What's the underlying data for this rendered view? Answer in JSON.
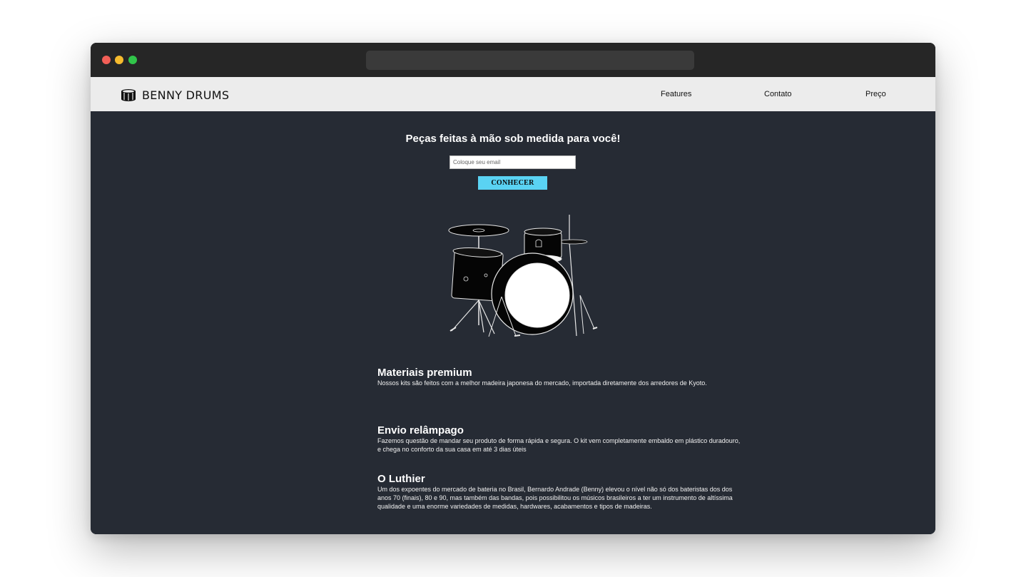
{
  "navbar": {
    "brand": "BENNY DRUMS",
    "brand_icon": "drum-icon",
    "links": [
      "Features",
      "Contato",
      "Preço"
    ]
  },
  "hero": {
    "title": "Peças feitas à mão sob medida para você!",
    "email_placeholder": "Coloque seu email",
    "button_label": "CONHECER",
    "image": "drum-kit-illustration"
  },
  "features": [
    {
      "title": "Materiais premium",
      "text": "Nossos kits são feitos com a melhor madeira japonesa do mercado, importada diretamente dos arredores de Kyoto."
    },
    {
      "title": "Envio relâmpago",
      "text": "Fazemos questão de mandar seu produto de forma rápida e segura. O kit vem completamente embaldo em plástico duradouro, e chega no conforto da sua casa em até 3 dias úteis"
    },
    {
      "title": "O Luthier",
      "text": "Um dos expoentes do mercado de bateria no Brasil, Bernardo Andrade (Benny) elevou o nível não só dos bateristas dos dos anos 70 (finais), 80 e 90, mas também das bandas, pois possibilitou os músicos brasileiros a ter um instrumento de altíssima qualidade e uma enorme variedades de medidas, hardwares, acabamentos e tipos de madeiras."
    }
  ],
  "colors": {
    "titlebar": "#262626",
    "navbar": "#ececec",
    "page_background": "#262b34",
    "button": "#5ad3f3"
  }
}
